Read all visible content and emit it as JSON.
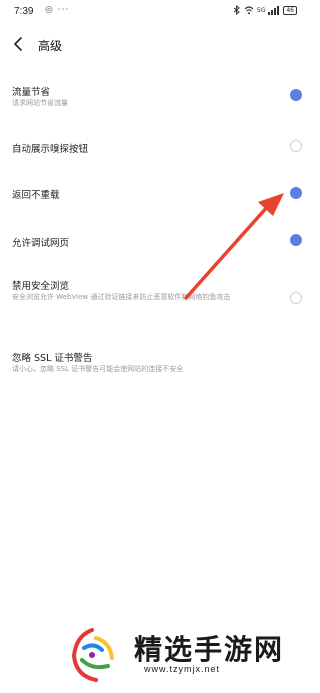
{
  "status_bar": {
    "time": "7:39",
    "left_icons": "◎ ···",
    "right_icons": [
      "bluetooth-icon",
      "wifi-icon",
      "signal-icon"
    ],
    "network_label": "5G",
    "battery": "46"
  },
  "header": {
    "title": "高级"
  },
  "settings": [
    {
      "title": "流量节省",
      "subtitle": "请求网站节省流量",
      "enabled": true
    },
    {
      "title": "自动展示嗅探按钮",
      "subtitle": "",
      "enabled": false
    },
    {
      "title": "返回不重载",
      "subtitle": "",
      "enabled": true
    },
    {
      "title": "允许调试网页",
      "subtitle": "",
      "enabled": true
    },
    {
      "title": "禁用安全浏览",
      "subtitle": "安全浏览允许 WebView 通过验证链接来防止恶意软件和网络钓鱼攻击",
      "enabled": false
    },
    {
      "title": "忽略 SSL 证书警告",
      "subtitle": "请小心，忽略 SSL 证书警告可能会使网站的连接不安全",
      "enabled": null
    }
  ],
  "colors": {
    "accent": "#5b7de6",
    "arrow": "#e8432f"
  },
  "watermark": {
    "title": "精选手游网",
    "url": "www.tzymjx.net"
  }
}
